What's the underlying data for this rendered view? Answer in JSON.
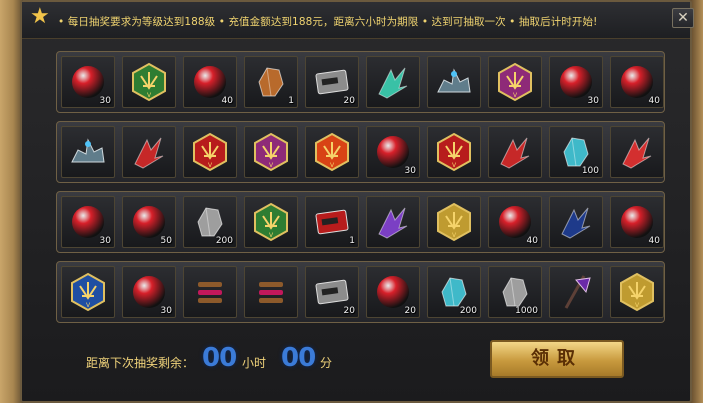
{
  "notice": "• 每日抽奖要求为等级达到188级 • 充值金额达到188元，距离六小时为期限 • 达到可抽取一次 • 抽取后计时开始!",
  "close_label": "✕",
  "footer": {
    "countdown_label": "距离下次抽奖剩余：",
    "hours": "00",
    "hours_unit": "小时",
    "minutes": "00",
    "minutes_unit": "分",
    "claim_label": "领取"
  },
  "rows": [
    [
      {
        "icon": "red-gem-icon",
        "count": "30",
        "color": "#d8202a"
      },
      {
        "icon": "green-emblem-icon",
        "count": "",
        "color": "#2e7d32"
      },
      {
        "icon": "green-gem-icon",
        "count": "40",
        "color": "#26c93a"
      },
      {
        "icon": "amber-crystal-icon",
        "count": "1",
        "color": "#b86a2c"
      },
      {
        "icon": "card-icon",
        "count": "20",
        "color": "#8c8c8c"
      },
      {
        "icon": "feather-wings-icon",
        "count": "",
        "color": "#39c1a6"
      },
      {
        "icon": "mecha-mount-icon",
        "count": "",
        "color": "#607d8b"
      },
      {
        "icon": "purple-emblem-icon",
        "count": "",
        "color": "#8e2a78"
      },
      {
        "icon": "green-gem-icon",
        "count": "30",
        "color": "#26c93a"
      },
      {
        "icon": "yellow-gem-icon",
        "count": "40",
        "color": "#f0b714"
      }
    ],
    [
      {
        "icon": "mecha-mount-icon",
        "count": "",
        "color": "#607d8b"
      },
      {
        "icon": "red-wings-icon",
        "count": "",
        "color": "#c62828"
      },
      {
        "icon": "red-emblem-icon",
        "count": "",
        "color": "#b71c1c"
      },
      {
        "icon": "purple-emblem-icon",
        "count": "",
        "color": "#8e2a78"
      },
      {
        "icon": "red-emblem-icon",
        "count": "",
        "color": "#d84315"
      },
      {
        "icon": "yellow-gem-icon",
        "count": "30",
        "color": "#f0b714"
      },
      {
        "icon": "red-emblem-icon",
        "count": "",
        "color": "#b71c1c"
      },
      {
        "icon": "red-wings-icon",
        "count": "",
        "color": "#c62828"
      },
      {
        "icon": "cyan-crystal-icon",
        "count": "100",
        "color": "#3fb9c9"
      },
      {
        "icon": "red-claw-icon",
        "count": "",
        "color": "#d32f2f"
      }
    ],
    [
      {
        "icon": "orange-gem-icon",
        "count": "30",
        "color": "#f36a16"
      },
      {
        "icon": "green-gem-icon",
        "count": "50",
        "color": "#26c93a"
      },
      {
        "icon": "silver-ore-icon",
        "count": "200",
        "color": "#9e9e9e"
      },
      {
        "icon": "green-emblem-icon",
        "count": "",
        "color": "#2e7d32"
      },
      {
        "icon": "red-card-icon",
        "count": "1",
        "color": "#b71c1c"
      },
      {
        "icon": "purple-wings-icon",
        "count": "",
        "color": "#7b3fc4"
      },
      {
        "icon": "gold-emblem-icon",
        "count": "",
        "color": "#bf9b30"
      },
      {
        "icon": "orange-gem-icon",
        "count": "40",
        "color": "#f36a16"
      },
      {
        "icon": "blue-wings-icon",
        "count": "",
        "color": "#1e3a8a"
      },
      {
        "icon": "yellow-gem-icon",
        "count": "40",
        "color": "#f0b714"
      }
    ],
    [
      {
        "icon": "blue-emblem-icon",
        "count": "",
        "color": "#1f4fa3"
      },
      {
        "icon": "teal-orb-icon",
        "count": "30",
        "color": "#1f8f9c"
      },
      {
        "icon": "scroll-bundle-icon",
        "count": "",
        "color": "#8d5a2b"
      },
      {
        "icon": "scroll-bundle-icon",
        "count": "",
        "color": "#8d5a2b"
      },
      {
        "icon": "card-icon",
        "count": "20",
        "color": "#8c8c8c"
      },
      {
        "icon": "teal-orb-icon",
        "count": "20",
        "color": "#1f8f9c"
      },
      {
        "icon": "cyan-crystal-icon",
        "count": "200",
        "color": "#3fb9c9"
      },
      {
        "icon": "silver-ore-icon",
        "count": "1000",
        "color": "#9e9e9e"
      },
      {
        "icon": "purple-axe-icon",
        "count": "",
        "color": "#6a2aa8"
      },
      {
        "icon": "gold-emblem-icon",
        "count": "",
        "color": "#bf9b30"
      }
    ]
  ]
}
